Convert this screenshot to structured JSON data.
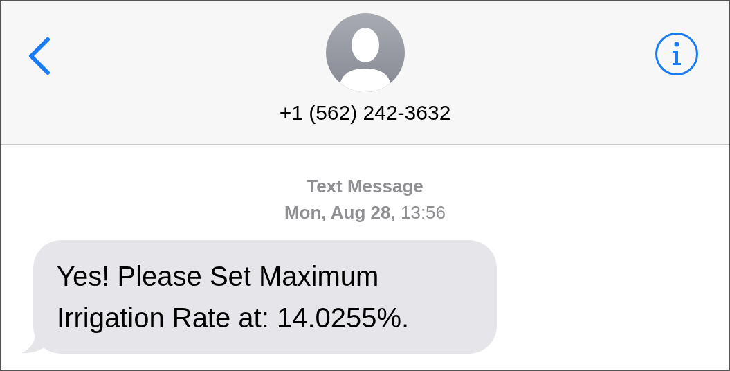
{
  "header": {
    "contact": "+1 (562) 242-3632"
  },
  "thread": {
    "service": "Text Message",
    "timestamp": "**Mon, Aug 28,** 13:56"
  },
  "messages": [
    {
      "kind": "incoming",
      "text": "Yes! Please Set Maximum Irrigation Rate at: 14.0255%."
    }
  ]
}
